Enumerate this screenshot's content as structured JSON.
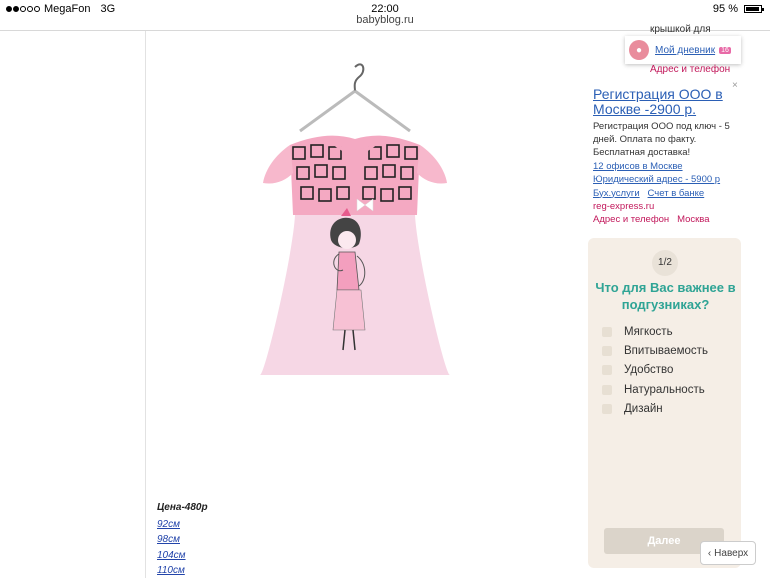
{
  "statusbar": {
    "carrier": "MegaFon",
    "network": "3G",
    "time": "22:00",
    "battery": "95 %"
  },
  "url": "babyblog.ru",
  "product": {
    "price": "Цена-480р",
    "sizes": [
      "92см",
      "98см",
      "104см",
      "110см"
    ]
  },
  "sidebar": {
    "cut_text": "крышкой для",
    "diary": {
      "label": "Мой дневник",
      "badge": "16"
    },
    "address_top": "Адрес и телефон"
  },
  "ad": {
    "title": "Регистрация ООО в Москве -2900 р.",
    "close": "×",
    "body": "Регистрация ООО под ключ - 5 дней. Оплата по факту. Бесплатная доставка!",
    "link1": "12 офисов в Москве",
    "link2": "Юридический адрес - 5900 р",
    "link3": "Бух.услуги",
    "link4": "Счет в банке",
    "url": "reg-express.ru",
    "address": "Адрес и телефон",
    "city": "Москва"
  },
  "poll": {
    "step": "1/2",
    "question": "Что для Вас важнее в подгузниках?",
    "options": [
      "Мягкость",
      "Впитываемость",
      "Удобство",
      "Натуральность",
      "Дизайн"
    ],
    "button": "Далее"
  },
  "nav": {
    "next_label": "Наверх"
  }
}
